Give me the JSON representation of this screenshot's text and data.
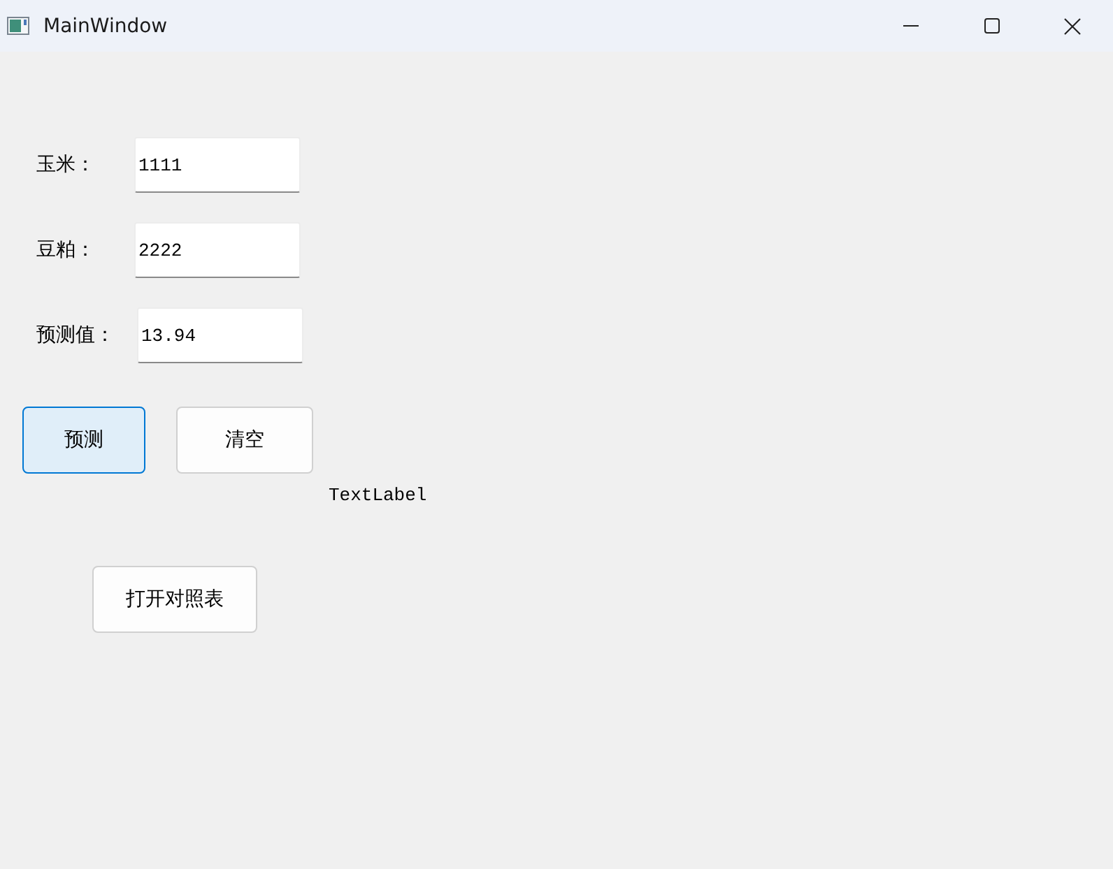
{
  "window": {
    "title": "MainWindow"
  },
  "fields": [
    {
      "label": "玉米：",
      "value": "1111"
    },
    {
      "label": "豆粕：",
      "value": "2222"
    },
    {
      "label": "预测值：",
      "value": "13.94"
    }
  ],
  "buttons": [
    {
      "label": "预测",
      "focused": true
    },
    {
      "label": "清空",
      "focused": false
    }
  ],
  "text_label": "TextLabel",
  "table_button": {
    "label": "打开对照表",
    "focused": false
  }
}
